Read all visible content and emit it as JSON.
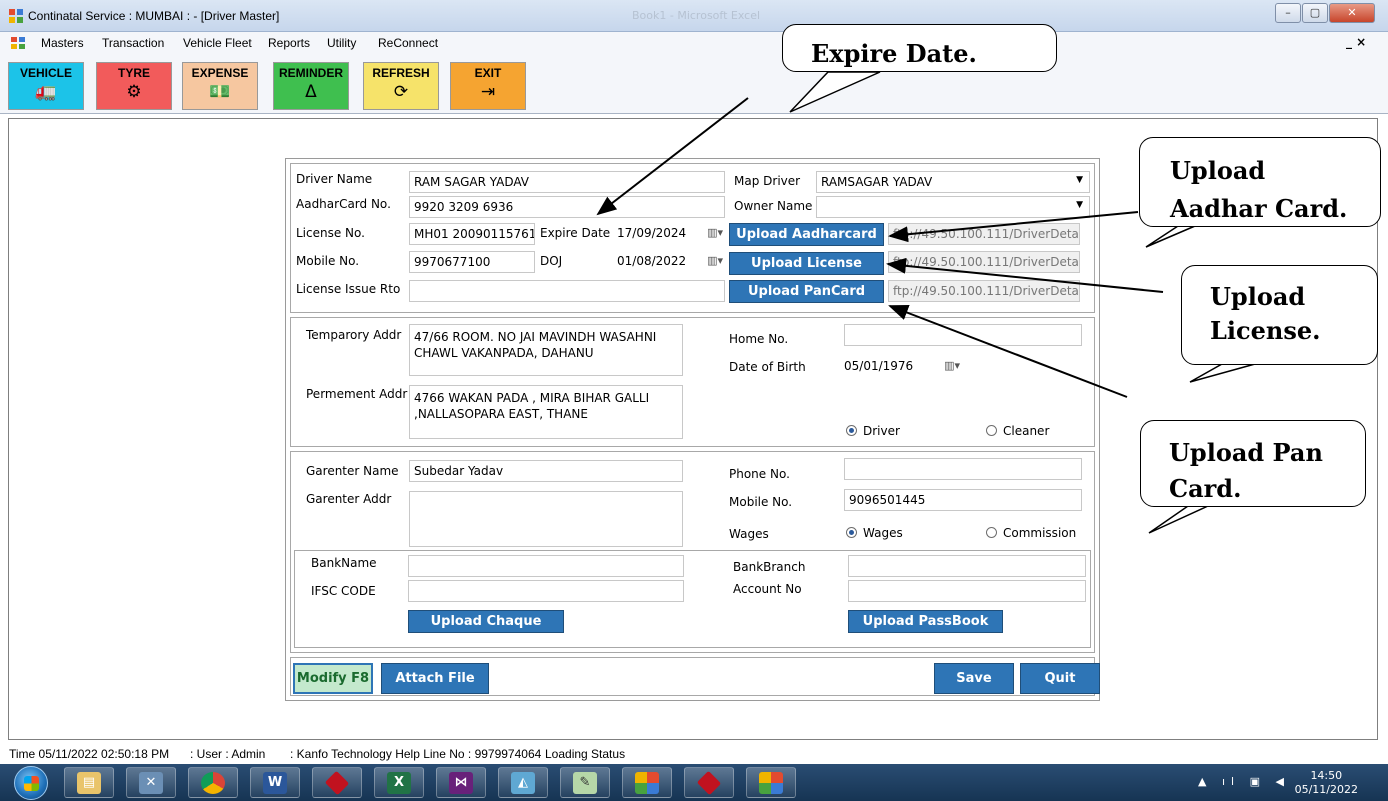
{
  "window": {
    "title": "Continatal Service : MUMBAI : - [Driver Master]",
    "background_title": "Book1 - Microsoft Excel",
    "buttons": [
      "minimize",
      "maximize",
      "close"
    ]
  },
  "menubar": {
    "items": [
      "Masters",
      "Transaction",
      "Vehicle Fleet",
      "Reports",
      "Utility",
      "ReConnect"
    ],
    "mdi_controls": "_ ×"
  },
  "toolbar": {
    "buttons": [
      {
        "label": "VEHICLE",
        "icon": "truck-icon",
        "glyph": "🚛",
        "color": "#1cc3e8"
      },
      {
        "label": "TYRE",
        "icon": "tyre-icon",
        "glyph": "⚙",
        "color": "#f25b5b"
      },
      {
        "label": "EXPENSE",
        "icon": "cash-icon",
        "glyph": "💵",
        "color": "#f6c7a0"
      },
      {
        "label": "REMINDER",
        "icon": "bell-icon",
        "glyph": "Δ",
        "color": "#3fbf4f"
      },
      {
        "label": "REFRESH",
        "icon": "refresh-icon",
        "glyph": "⟳",
        "color": "#f6e36a"
      },
      {
        "label": "EXIT",
        "icon": "exit-icon",
        "glyph": "⇥",
        "color": "#f5a431"
      }
    ]
  },
  "form": {
    "driver_name_label": "Driver Name",
    "driver_name": "RAM SAGAR YADAV",
    "map_driver_label": "Map Driver",
    "map_driver": "RAMSAGAR YADAV",
    "aadhar_label": "AadharCard No.",
    "aadhar": "9920 3209 6936",
    "owner_name_label": "Owner Name",
    "owner_name": "",
    "license_label": "License No.",
    "license": "MH01 20090115761",
    "expire_date_label": "Expire Date",
    "expire_date": "17/09/2024",
    "upload_aadhar_button": "Upload Aadharcard",
    "aadhar_path": "ftp://49.50.100.111/DriverDetail",
    "mobile_label": "Mobile No.",
    "mobile": "9970677100",
    "doj_label": "DOJ",
    "doj": "01/08/2022",
    "upload_license_button": "Upload License",
    "license_path": "ftp://49.50.100.111/DriverDetail",
    "issue_rto_label": "License Issue Rto",
    "issue_rto": "",
    "upload_pan_button": "Upload PanCard",
    "pan_path": "ftp://49.50.100.111/DriverDetail",
    "temp_addr_label": "Temparory Addr",
    "temp_addr": "47/66 ROOM. NO JAI MAVINDH WASAHNI CHAWL VAKANPADA, DAHANU",
    "perm_addr_label": "Permement Addr",
    "perm_addr": "4766 WAKAN PADA , MIRA BIHAR GALLI ,NALLASOPARA EAST, THANE",
    "home_no_label": "Home No.",
    "home_no": "",
    "dob_label": "Date of Birth",
    "dob": "05/01/1976",
    "role_options": [
      "Driver",
      "Cleaner"
    ],
    "role_selected": "Driver",
    "garenter_name_label": "Garenter Name",
    "garenter_name": "Subedar Yadav",
    "garenter_addr_label": "Garenter  Addr",
    "garenter_addr": "",
    "phone_label": "Phone No.",
    "phone": "",
    "g_mobile_label": "Mobile No.",
    "g_mobile": "9096501445",
    "wages_label": "Wages",
    "pay_options": [
      "Wages",
      "Commission"
    ],
    "pay_selected": "Wages",
    "bank_name_label": "BankName",
    "bank_name": "",
    "bank_branch_label": "BankBranch",
    "bank_branch": "",
    "ifsc_label": "IFSC CODE",
    "ifsc": "",
    "account_label": "Account No",
    "account": "",
    "upload_cheque_button": "Upload Chaque",
    "upload_passbook_button": "Upload PassBook",
    "modify_button": "Modify F8",
    "attach_button": "Attach File",
    "save_button": "Save",
    "quit_button": "Quit"
  },
  "statusbar": {
    "time": "Time  05/11/2022 02:50:18 PM",
    "user": ": User : Admin",
    "help": ": Kanfo Technology Help Line No : 9979974064",
    "loading": "Loading Status"
  },
  "callouts": {
    "expire": "Expire Date.",
    "aadhar_1": "Upload",
    "aadhar_2": "Aadhar Card.",
    "license_1": "Upload",
    "license_2": "License.",
    "pan_1": "Upload Pan",
    "pan_2": "Card."
  },
  "taskbar": {
    "apps": [
      "file-explorer-icon",
      "tools-icon",
      "chrome-icon",
      "word-icon",
      "red-app-icon",
      "excel-icon",
      "visual-studio-icon",
      "notes-icon",
      "editor-icon",
      "windows-app-icon",
      "red-app-icon",
      "windows-app-icon"
    ],
    "clock_time": "14:50",
    "clock_date": "05/11/2022"
  }
}
